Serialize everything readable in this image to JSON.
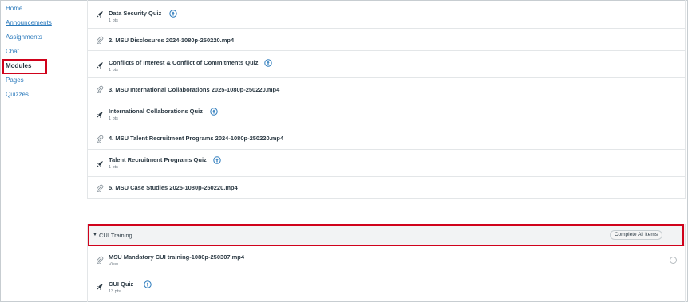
{
  "sidebar": {
    "items": [
      {
        "label": "Home"
      },
      {
        "label": "Announcements"
      },
      {
        "label": "Assignments"
      },
      {
        "label": "Chat"
      },
      {
        "label": "Modules"
      },
      {
        "label": "Pages"
      },
      {
        "label": "Quizzes"
      }
    ]
  },
  "module1": {
    "items": [
      {
        "type": "quiz",
        "title": "Data Security Quiz",
        "sub": "1 pts"
      },
      {
        "type": "attachment",
        "title": "2. MSU Disclosures 2024-1080p-250220.mp4"
      },
      {
        "type": "quiz",
        "title": "Conflicts of Interest & Conflict of Commitments Quiz",
        "sub": "1 pts"
      },
      {
        "type": "attachment",
        "title": "3. MSU International Collaborations 2025-1080p-250220.mp4"
      },
      {
        "type": "quiz",
        "title": "International Collaborations Quiz",
        "sub": "1 pts"
      },
      {
        "type": "attachment",
        "title": "4. MSU Talent Recruitment Programs 2024-1080p-250220.mp4"
      },
      {
        "type": "quiz",
        "title": "Talent Recruitment Programs Quiz",
        "sub": "1 pts"
      },
      {
        "type": "attachment",
        "title": "5. MSU Case Studies 2025-1080p-250220.mp4"
      }
    ]
  },
  "module2": {
    "title": "CUI Training",
    "complete_label": "Complete All Items",
    "items": [
      {
        "type": "attachment",
        "title": "MSU Mandatory CUI training-1080p-250307.mp4",
        "sub": "View"
      },
      {
        "type": "quiz",
        "title": "CUI Quiz",
        "sub": "13 pts"
      }
    ]
  },
  "colors": {
    "link": "#2b7abc",
    "highlight": "#d0021b",
    "header_bg": "#f2f3f4"
  }
}
